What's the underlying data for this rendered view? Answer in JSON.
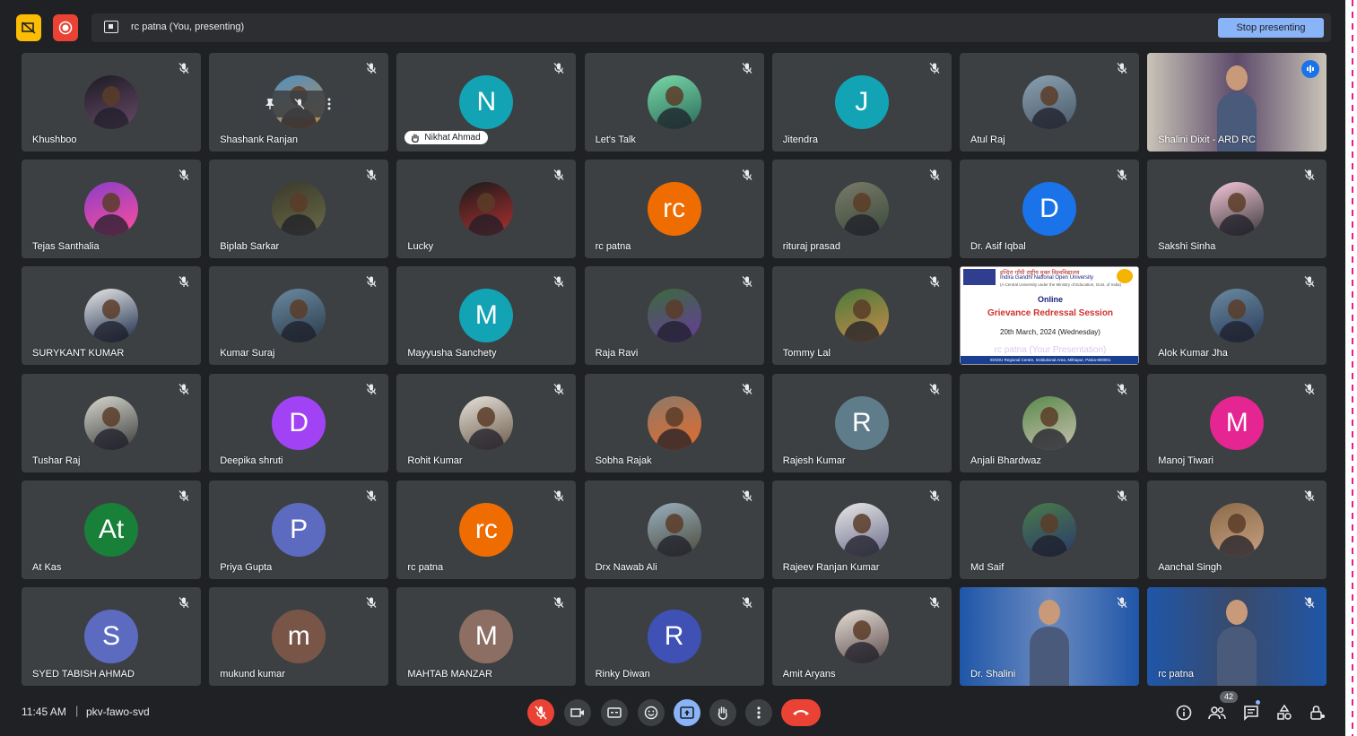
{
  "top_bar": {
    "presenting_text": "rc patna (You, presenting)",
    "stop_presenting_label": "Stop presenting"
  },
  "participants": [
    {
      "name": "Khushboo",
      "type": "photo",
      "colors": [
        "#1b1b22",
        "#6a4a6a"
      ]
    },
    {
      "name": "Shashank Ranjan",
      "type": "photo",
      "colors": [
        "#4b90c6",
        "#c98a3d"
      ],
      "hover_controls": true
    },
    {
      "name": "",
      "type": "letter",
      "letter": "N",
      "color": "#12a4b4",
      "name_pill": "Nikhat Ahmad"
    },
    {
      "name": "Let's Talk",
      "type": "photo",
      "colors": [
        "#7ad9a8",
        "#2a6a5a"
      ]
    },
    {
      "name": "Jitendra",
      "type": "letter",
      "letter": "J",
      "color": "#12a4b4"
    },
    {
      "name": "Atul Raj",
      "type": "photo",
      "colors": [
        "#8aa0b0",
        "#4a5a6a"
      ]
    },
    {
      "name": "Shalini Dixit - ARD RC",
      "type": "video",
      "colors": [
        "#c9c4b8",
        "#5d4a6a"
      ],
      "speaking": true
    },
    {
      "name": "Tejas Santhalia",
      "type": "photo",
      "colors": [
        "#8a3ec8",
        "#ff4f9a"
      ]
    },
    {
      "name": "Biplab Sarkar",
      "type": "photo",
      "colors": [
        "#3a3a2a",
        "#6a6a4a"
      ]
    },
    {
      "name": "Lucky",
      "type": "photo",
      "colors": [
        "#1a1a1a",
        "#b03030"
      ]
    },
    {
      "name": "rc patna",
      "type": "letter",
      "letter": "rc",
      "color": "#ef6c00"
    },
    {
      "name": "rituraj prasad",
      "type": "photo",
      "colors": [
        "#7a7a6a",
        "#3a4a3a"
      ]
    },
    {
      "name": "Dr. Asif Iqbal",
      "type": "letter",
      "letter": "D",
      "color": "#1a73e8"
    },
    {
      "name": "Sakshi Sinha",
      "type": "photo",
      "colors": [
        "#f6c6d8",
        "#3a3a3a"
      ]
    },
    {
      "name": "SURYKANT KUMAR",
      "type": "photo",
      "colors": [
        "#e8e8e8",
        "#1a2a4a"
      ]
    },
    {
      "name": "Kumar Suraj",
      "type": "photo",
      "colors": [
        "#6a8aa0",
        "#2a3a4a"
      ]
    },
    {
      "name": "Mayyusha Sanchety",
      "type": "letter",
      "letter": "M",
      "color": "#12a4b4"
    },
    {
      "name": "Raja Ravi",
      "type": "photo",
      "colors": [
        "#3a6a3a",
        "#6a3aa0"
      ]
    },
    {
      "name": "Tommy Lal",
      "type": "photo",
      "colors": [
        "#4a7a3a",
        "#c88a4a"
      ]
    },
    {
      "name": "rc patna (Your Presentation)",
      "type": "slide"
    },
    {
      "name": "Alok Kumar Jha",
      "type": "photo",
      "colors": [
        "#6a8aa0",
        "#2a3a5a"
      ]
    },
    {
      "name": "Tushar Raj",
      "type": "photo",
      "colors": [
        "#d8d8d0",
        "#3a3a3a"
      ]
    },
    {
      "name": "Deepika shruti",
      "type": "letter",
      "letter": "D",
      "color": "#a142f4"
    },
    {
      "name": "Rohit Kumar",
      "type": "photo",
      "colors": [
        "#e6e2da",
        "#6a5a4a"
      ]
    },
    {
      "name": "Sobha Rajak",
      "type": "photo",
      "colors": [
        "#8a7a6a",
        "#e86a2a"
      ]
    },
    {
      "name": "Rajesh Kumar",
      "type": "letter",
      "letter": "R",
      "color": "#5f7c8a"
    },
    {
      "name": "Anjali Bhardwaz",
      "type": "photo",
      "colors": [
        "#5a8a4a",
        "#c8c0b0"
      ]
    },
    {
      "name": "Manoj Tiwari",
      "type": "letter",
      "letter": "M",
      "color": "#e52592"
    },
    {
      "name": "At Kas",
      "type": "letter",
      "letter": "At",
      "color": "#188038"
    },
    {
      "name": "Priya Gupta",
      "type": "letter",
      "letter": "P",
      "color": "#5c6bc0"
    },
    {
      "name": "rc patna",
      "type": "letter",
      "letter": "rc",
      "color": "#ef6c00"
    },
    {
      "name": "Drx Nawab Ali",
      "type": "photo",
      "colors": [
        "#9ab0c0",
        "#4a4a3a"
      ]
    },
    {
      "name": "Rajeev Ranjan Kumar",
      "type": "photo",
      "colors": [
        "#e8e8e8",
        "#6a6a8a"
      ]
    },
    {
      "name": "Md Saif",
      "type": "photo",
      "colors": [
        "#4a7a4a",
        "#2a3a6a"
      ]
    },
    {
      "name": "Aanchal Singh",
      "type": "photo",
      "colors": [
        "#8a6a4a",
        "#c8a080"
      ]
    },
    {
      "name": "SYED TABISH AHMAD",
      "type": "letter",
      "letter": "S",
      "color": "#5c6bc0"
    },
    {
      "name": "mukund kumar",
      "type": "letter",
      "letter": "m",
      "color": "#795548"
    },
    {
      "name": "MAHTAB MANZAR",
      "type": "letter",
      "letter": "M",
      "color": "#8d6e63"
    },
    {
      "name": "Rinky Diwan",
      "type": "letter",
      "letter": "R",
      "color": "#3f51b5"
    },
    {
      "name": "Amit Aryans",
      "type": "photo",
      "colors": [
        "#e8e0d8",
        "#5a4a4a"
      ]
    },
    {
      "name": "Dr. Shalini",
      "type": "video",
      "colors": [
        "#1f56a8",
        "#6a8ac0"
      ]
    },
    {
      "name": "rc patna",
      "type": "video",
      "colors": [
        "#1f56a8",
        "#3a4a6a"
      ]
    }
  ],
  "slide": {
    "header_hindi": "इन्दिरा गाँधी राष्ट्रीय मुक्त विश्वविद्यालय",
    "header_english": "Indira Gandhi National Open University",
    "header_sub": "(A Central University under the Ministry of Education, Govt. of India)",
    "online": "Online",
    "title": "Grievance Redressal Session",
    "date": "20th March, 2024 (Wednesday)",
    "overlay": "rc patna (Your Presentation)",
    "footer": "IGNOU Regional Centre, Institutional Area, Mithapur, Patna-800001"
  },
  "bottom_bar": {
    "time": "11:45 AM",
    "separator": "|",
    "meeting_code": "pkv-fawo-svd",
    "people_count": "42"
  }
}
